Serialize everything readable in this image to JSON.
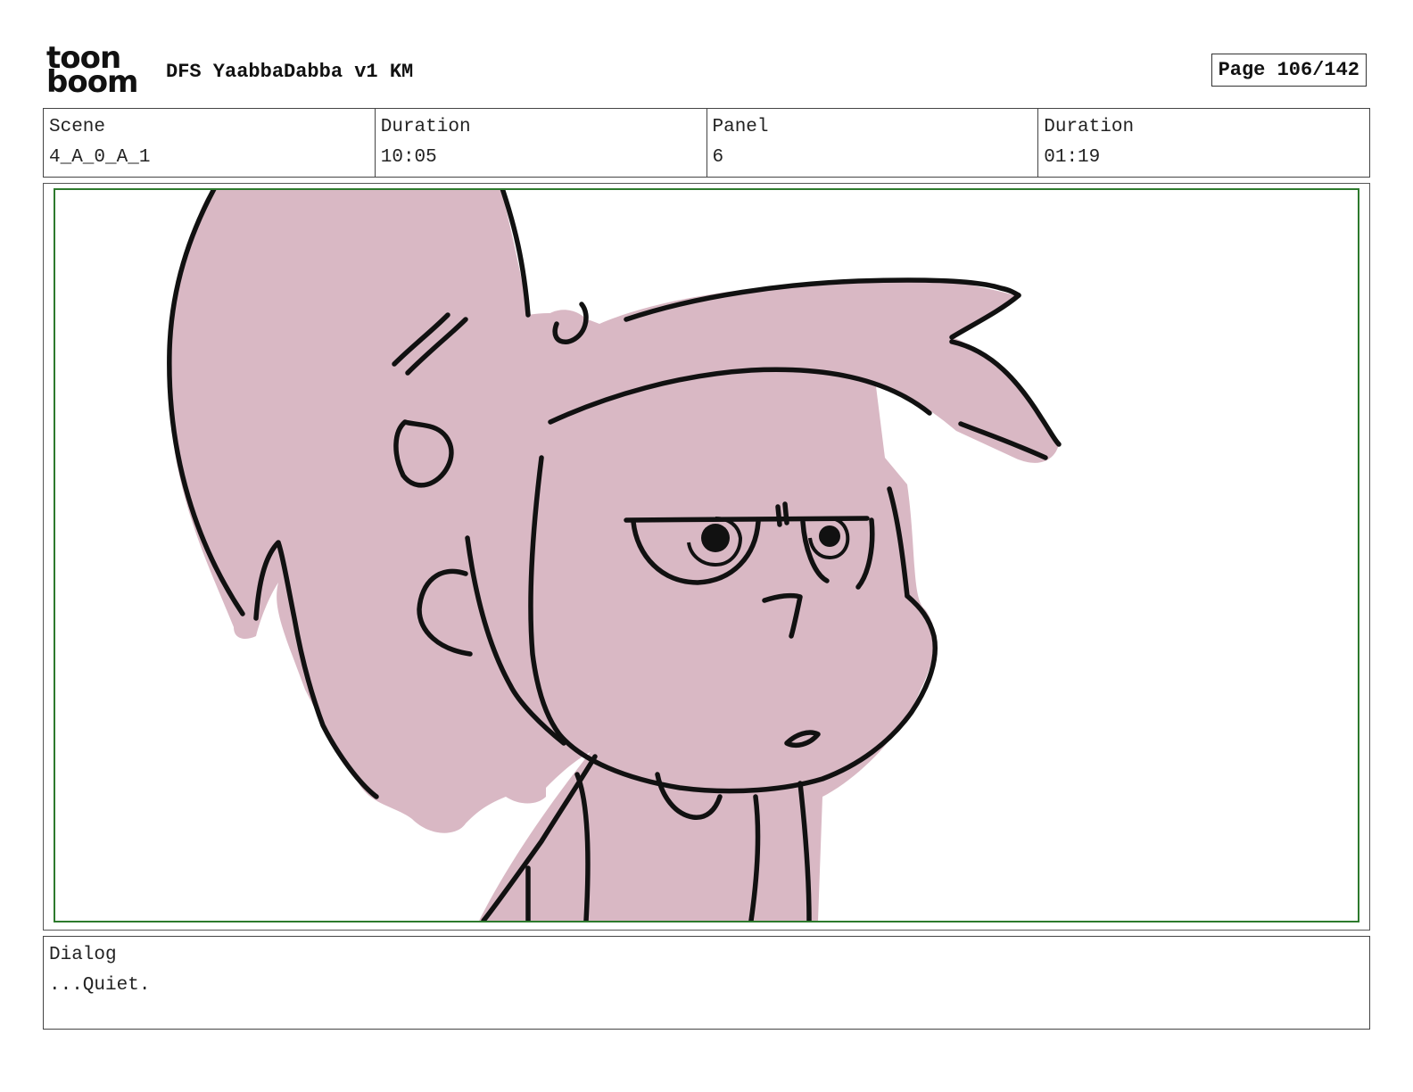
{
  "header": {
    "logo_line1": "toon",
    "logo_line2": "boom",
    "project_title": "DFS YaabbaDabba v1 KM",
    "page_label": "Page 106/142"
  },
  "info": {
    "scene_label": "Scene",
    "scene_value": "4_A_0_A_1",
    "scene_duration_label": "Duration",
    "scene_duration_value": "10:05",
    "panel_label": "Panel",
    "panel_value": "6",
    "panel_duration_label": "Duration",
    "panel_duration_value": "01:19"
  },
  "dialog": {
    "label": "Dialog",
    "text": "...Quiet."
  },
  "colors": {
    "skin_fill": "#d9b8c4",
    "line": "#111111",
    "safe_frame": "#2d7a2d"
  }
}
